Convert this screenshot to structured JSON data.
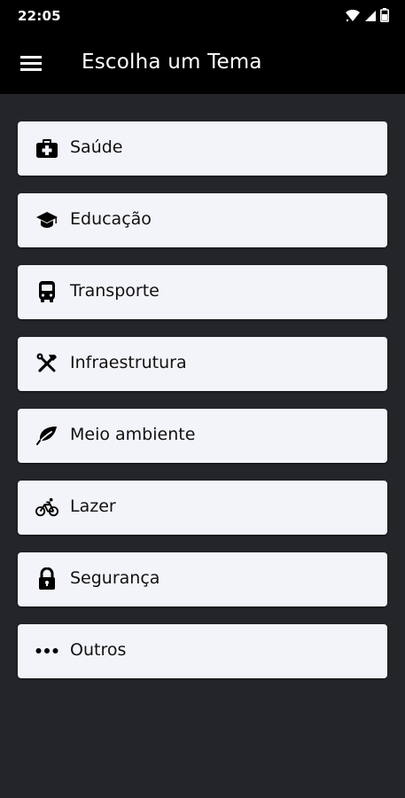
{
  "status_bar": {
    "time": "22:05",
    "icons": [
      "wifi-icon",
      "signal-icon",
      "battery-icon"
    ]
  },
  "app_bar": {
    "title": "Escolha um Tema",
    "menu_icon": "menu-icon"
  },
  "colors": {
    "bars": "#000000",
    "background": "#242528",
    "card": "#f3f4f9",
    "text": "#111111"
  },
  "themes": [
    {
      "label": "Saúde",
      "icon": "medical-kit-icon"
    },
    {
      "label": "Educação",
      "icon": "graduation-cap-icon"
    },
    {
      "label": "Transporte",
      "icon": "bus-icon"
    },
    {
      "label": "Infraestrutura",
      "icon": "tools-icon"
    },
    {
      "label": "Meio ambiente",
      "icon": "leaf-icon"
    },
    {
      "label": "Lazer",
      "icon": "bicycle-icon"
    },
    {
      "label": "Segurança",
      "icon": "lock-icon"
    },
    {
      "label": "Outros",
      "icon": "more-horizontal-icon"
    }
  ]
}
